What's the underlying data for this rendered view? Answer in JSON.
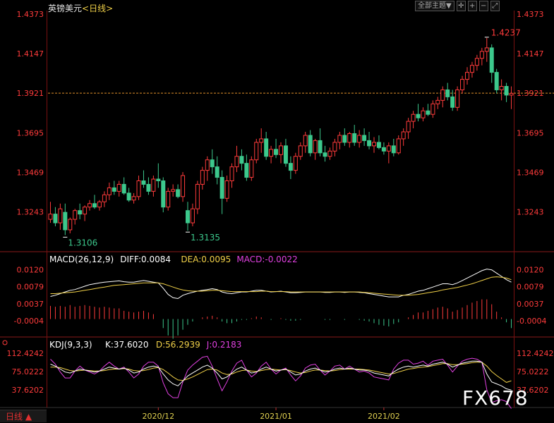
{
  "header": {
    "title": "英镑美元",
    "period_tag": "<日线>",
    "theme_label": "全部主题▼",
    "tool_icons": [
      "crosshair-icon",
      "zoom-in-icon",
      "zoom-out-icon",
      "expand-icon"
    ]
  },
  "footer": {
    "period_button": "日线 ▲",
    "watermark": "FX678"
  },
  "colors": {
    "up": "#ff3b3b",
    "down": "#3cc88c",
    "macd_diff": "#ffffff",
    "macd_dea": "#f0d048",
    "macd_bar": "#e040e0",
    "kdj_k": "#ffffff",
    "kdj_d": "#f0d048",
    "kdj_j": "#e040e0"
  },
  "chart_data": [
    {
      "type": "candlestick",
      "title": "英镑美元",
      "y_ticks": [
        "1.4373",
        "1.4147",
        "1.3921",
        "1.3695",
        "1.3469",
        "1.3243"
      ],
      "ylim": [
        1.3015,
        1.4373
      ],
      "current_price_line": 1.3921,
      "annotations": [
        {
          "label": "1.3106",
          "value": 1.3106,
          "index": 3,
          "kind": "low"
        },
        {
          "label": "1.3135",
          "value": 1.3135,
          "index": 28,
          "kind": "low"
        },
        {
          "label": "1.4237",
          "value": 1.4237,
          "index": 89,
          "kind": "high"
        }
      ],
      "x_ticks": [
        {
          "label": "2020/12",
          "index": 22
        },
        {
          "label": "2021/01",
          "index": 46
        },
        {
          "label": "2021/02",
          "index": 68
        }
      ],
      "ohlc": [
        [
          1.32,
          1.33,
          1.318,
          1.323
        ],
        [
          1.323,
          1.327,
          1.316,
          1.318
        ],
        [
          1.318,
          1.329,
          1.314,
          1.326
        ],
        [
          1.324,
          1.329,
          1.311,
          1.314
        ],
        [
          1.314,
          1.321,
          1.312,
          1.32
        ],
        [
          1.32,
          1.326,
          1.317,
          1.325
        ],
        [
          1.325,
          1.329,
          1.32,
          1.323
        ],
        [
          1.323,
          1.328,
          1.319,
          1.327
        ],
        [
          1.327,
          1.331,
          1.325,
          1.329
        ],
        [
          1.329,
          1.334,
          1.326,
          1.327
        ],
        [
          1.327,
          1.331,
          1.325,
          1.33
        ],
        [
          1.33,
          1.336,
          1.327,
          1.334
        ],
        [
          1.334,
          1.341,
          1.331,
          1.338
        ],
        [
          1.338,
          1.342,
          1.334,
          1.336
        ],
        [
          1.336,
          1.342,
          1.333,
          1.34
        ],
        [
          1.34,
          1.344,
          1.334,
          1.335
        ],
        [
          1.335,
          1.338,
          1.33,
          1.331
        ],
        [
          1.331,
          1.335,
          1.329,
          1.333
        ],
        [
          1.333,
          1.345,
          1.331,
          1.342
        ],
        [
          1.342,
          1.348,
          1.338,
          1.34
        ],
        [
          1.34,
          1.344,
          1.334,
          1.336
        ],
        [
          1.336,
          1.345,
          1.333,
          1.343
        ],
        [
          1.343,
          1.352,
          1.338,
          1.342
        ],
        [
          1.342,
          1.344,
          1.324,
          1.327
        ],
        [
          1.327,
          1.338,
          1.325,
          1.336
        ],
        [
          1.336,
          1.34,
          1.333,
          1.337
        ],
        [
          1.337,
          1.34,
          1.332,
          1.333
        ],
        [
          1.333,
          1.347,
          1.33,
          1.345
        ],
        [
          1.325,
          1.33,
          1.3135,
          1.318
        ],
        [
          1.318,
          1.329,
          1.316,
          1.326
        ],
        [
          1.326,
          1.342,
          1.323,
          1.34
        ],
        [
          1.34,
          1.35,
          1.337,
          1.348
        ],
        [
          1.348,
          1.356,
          1.342,
          1.354
        ],
        [
          1.354,
          1.36,
          1.346,
          1.35
        ],
        [
          1.35,
          1.356,
          1.34,
          1.344
        ],
        [
          1.344,
          1.348,
          1.323,
          1.332
        ],
        [
          1.332,
          1.345,
          1.33,
          1.342
        ],
        [
          1.342,
          1.352,
          1.338,
          1.35
        ],
        [
          1.35,
          1.362,
          1.347,
          1.356
        ],
        [
          1.356,
          1.36,
          1.348,
          1.352
        ],
        [
          1.352,
          1.357,
          1.342,
          1.344
        ],
        [
          1.344,
          1.356,
          1.342,
          1.354
        ],
        [
          1.354,
          1.366,
          1.352,
          1.364
        ],
        [
          1.364,
          1.372,
          1.358,
          1.366
        ],
        [
          1.366,
          1.37,
          1.354,
          1.356
        ],
        [
          1.356,
          1.362,
          1.352,
          1.36
        ],
        [
          1.36,
          1.366,
          1.355,
          1.357
        ],
        [
          1.357,
          1.364,
          1.352,
          1.362
        ],
        [
          1.362,
          1.366,
          1.35,
          1.352
        ],
        [
          1.352,
          1.356,
          1.343,
          1.348
        ],
        [
          1.348,
          1.358,
          1.346,
          1.356
        ],
        [
          1.356,
          1.364,
          1.354,
          1.362
        ],
        [
          1.362,
          1.37,
          1.358,
          1.368
        ],
        [
          1.368,
          1.371,
          1.356,
          1.358
        ],
        [
          1.358,
          1.366,
          1.354,
          1.365
        ],
        [
          1.365,
          1.372,
          1.356,
          1.358
        ],
        [
          1.358,
          1.362,
          1.353,
          1.356
        ],
        [
          1.356,
          1.361,
          1.354,
          1.359
        ],
        [
          1.359,
          1.366,
          1.356,
          1.364
        ],
        [
          1.364,
          1.37,
          1.36,
          1.368
        ],
        [
          1.368,
          1.372,
          1.362,
          1.364
        ],
        [
          1.364,
          1.37,
          1.361,
          1.369
        ],
        [
          1.369,
          1.374,
          1.362,
          1.364
        ],
        [
          1.364,
          1.371,
          1.361,
          1.368
        ],
        [
          1.368,
          1.372,
          1.362,
          1.365
        ],
        [
          1.365,
          1.37,
          1.36,
          1.362
        ],
        [
          1.362,
          1.367,
          1.358,
          1.364
        ],
        [
          1.364,
          1.368,
          1.36,
          1.361
        ],
        [
          1.361,
          1.364,
          1.357,
          1.359
        ],
        [
          1.359,
          1.364,
          1.352,
          1.362
        ],
        [
          1.362,
          1.366,
          1.356,
          1.358
        ],
        [
          1.358,
          1.368,
          1.357,
          1.366
        ],
        [
          1.366,
          1.372,
          1.362,
          1.37
        ],
        [
          1.37,
          1.378,
          1.366,
          1.376
        ],
        [
          1.376,
          1.382,
          1.372,
          1.38
        ],
        [
          1.38,
          1.386,
          1.376,
          1.378
        ],
        [
          1.378,
          1.384,
          1.376,
          1.382
        ],
        [
          1.382,
          1.386,
          1.379,
          1.38
        ],
        [
          1.38,
          1.388,
          1.378,
          1.386
        ],
        [
          1.386,
          1.39,
          1.383,
          1.388
        ],
        [
          1.388,
          1.396,
          1.384,
          1.394
        ],
        [
          1.394,
          1.398,
          1.388,
          1.39
        ],
        [
          1.39,
          1.394,
          1.382,
          1.384
        ],
        [
          1.384,
          1.396,
          1.382,
          1.394
        ],
        [
          1.394,
          1.402,
          1.392,
          1.4
        ],
        [
          1.4,
          1.407,
          1.397,
          1.404
        ],
        [
          1.404,
          1.41,
          1.401,
          1.408
        ],
        [
          1.408,
          1.414,
          1.405,
          1.412
        ],
        [
          1.412,
          1.418,
          1.408,
          1.416
        ],
        [
          1.416,
          1.4237,
          1.41,
          1.418
        ],
        [
          1.418,
          1.42,
          1.398,
          1.404
        ],
        [
          1.404,
          1.406,
          1.392,
          1.394
        ],
        [
          1.394,
          1.4,
          1.388,
          1.396
        ],
        [
          1.396,
          1.398,
          1.387,
          1.391
        ],
        [
          1.391,
          1.396,
          1.383,
          1.392
        ]
      ]
    },
    {
      "type": "line",
      "title": "MACD(26,12,9)",
      "legend": [
        {
          "label": "MACD(26,12,9)",
          "color": "#ffffff"
        },
        {
          "label": "DIFF:0.0084",
          "color": "#ffffff"
        },
        {
          "label": "DEA:0.0095",
          "color": "#f0d048"
        },
        {
          "label": "MACD:-0.0022",
          "color": "#e040e0"
        }
      ],
      "y_ticks": [
        "0.0120",
        "0.0079",
        "0.0037",
        "-0.0004"
      ],
      "ylim": [
        -0.003,
        0.0135
      ],
      "diff": [
        0.0055,
        0.0058,
        0.0062,
        0.0066,
        0.007,
        0.0072,
        0.0076,
        0.008,
        0.0084,
        0.0086,
        0.0088,
        0.009,
        0.0091,
        0.0092,
        0.0093,
        0.0091,
        0.009,
        0.009,
        0.0092,
        0.0094,
        0.0092,
        0.009,
        0.0088,
        0.0075,
        0.006,
        0.0052,
        0.005,
        0.0058,
        0.0062,
        0.0065,
        0.0068,
        0.007,
        0.0072,
        0.0074,
        0.0072,
        0.0066,
        0.0063,
        0.0062,
        0.0064,
        0.0066,
        0.0066,
        0.0068,
        0.007,
        0.007,
        0.0068,
        0.0066,
        0.0067,
        0.0068,
        0.0066,
        0.0064,
        0.0064,
        0.0065,
        0.0066,
        0.0066,
        0.0066,
        0.0066,
        0.0065,
        0.0065,
        0.0066,
        0.0066,
        0.0065,
        0.0066,
        0.0066,
        0.0065,
        0.0064,
        0.0062,
        0.006,
        0.0058,
        0.0056,
        0.0054,
        0.0054,
        0.0054,
        0.0058,
        0.006,
        0.0064,
        0.0068,
        0.007,
        0.0074,
        0.0078,
        0.0082,
        0.0086,
        0.0086,
        0.0084,
        0.0088,
        0.0094,
        0.01,
        0.0106,
        0.0112,
        0.0118,
        0.0122,
        0.012,
        0.0112,
        0.0104,
        0.0096,
        0.009
      ],
      "dea": [
        0.0062,
        0.0062,
        0.0063,
        0.0064,
        0.0065,
        0.0066,
        0.0068,
        0.007,
        0.0072,
        0.0074,
        0.0076,
        0.0078,
        0.008,
        0.0082,
        0.0083,
        0.0084,
        0.0085,
        0.0086,
        0.0087,
        0.0088,
        0.0088,
        0.0088,
        0.0088,
        0.0086,
        0.0082,
        0.0078,
        0.0074,
        0.0071,
        0.0069,
        0.0068,
        0.0068,
        0.0068,
        0.0069,
        0.007,
        0.007,
        0.0069,
        0.0068,
        0.0067,
        0.0067,
        0.0067,
        0.0067,
        0.0067,
        0.0067,
        0.0068,
        0.0068,
        0.0067,
        0.0067,
        0.0067,
        0.0067,
        0.0066,
        0.0066,
        0.0066,
        0.0066,
        0.0066,
        0.0066,
        0.0066,
        0.0066,
        0.0066,
        0.0066,
        0.0066,
        0.0066,
        0.0066,
        0.0066,
        0.0066,
        0.0065,
        0.0064,
        0.0063,
        0.0062,
        0.0061,
        0.006,
        0.0059,
        0.0058,
        0.0058,
        0.0058,
        0.0059,
        0.006,
        0.0062,
        0.0064,
        0.0066,
        0.0068,
        0.0071,
        0.0073,
        0.0075,
        0.0077,
        0.008,
        0.0083,
        0.0086,
        0.009,
        0.0094,
        0.0098,
        0.0102,
        0.0103,
        0.0102,
        0.01,
        0.0096
      ],
      "hist": [
        0.0032,
        0.003,
        0.0032,
        0.003,
        0.0034,
        0.003,
        0.0032,
        0.0034,
        0.0032,
        0.003,
        0.0028,
        0.003,
        0.0028,
        0.0026,
        0.0026,
        0.002,
        0.0018,
        0.0016,
        0.0018,
        0.002,
        0.0016,
        0.0012,
        0.0,
        -0.0022,
        -0.004,
        -0.0048,
        -0.004,
        -0.0026,
        -0.0014,
        -0.0006,
        0.0,
        0.0004,
        0.0006,
        0.0008,
        0.0004,
        -0.0006,
        -0.001,
        -0.001,
        -0.0006,
        -0.0002,
        -0.0002,
        0.0002,
        0.0006,
        0.0004,
        0.0,
        -0.0002,
        0.0,
        0.0002,
        -0.0002,
        -0.0004,
        -0.0004,
        -0.0002,
        0.0,
        0.0,
        0.0,
        0.0,
        -0.0002,
        -0.0002,
        0.0,
        0.0,
        -0.0002,
        0.0,
        0.0,
        -0.0002,
        -0.0004,
        -0.0006,
        -0.001,
        -0.0014,
        -0.0016,
        -0.0018,
        -0.0012,
        -0.0008,
        0.0,
        0.0004,
        0.001,
        0.0016,
        0.0016,
        0.002,
        0.0024,
        0.0028,
        0.003,
        0.0026,
        0.0018,
        0.0022,
        0.0028,
        0.0034,
        0.004,
        0.0044,
        0.0048,
        0.0048,
        0.0036,
        0.0018,
        0.0004,
        -0.0008,
        -0.0022
      ]
    },
    {
      "type": "line",
      "title": "KDJ(9,3,3)",
      "legend": [
        {
          "label": "KDJ(9,3,3)",
          "color": "#ffffff"
        },
        {
          "label": "K:37.6020",
          "color": "#ffffff"
        },
        {
          "label": "D:56.2939",
          "color": "#f0d048"
        },
        {
          "label": "J:0.2183",
          "color": "#e040e0"
        }
      ],
      "y_ticks": [
        "112.4242",
        "75.0222",
        "37.6202"
      ],
      "ylim": [
        5,
        125
      ],
      "k": [
        90,
        86,
        80,
        74,
        72,
        76,
        80,
        78,
        76,
        74,
        76,
        80,
        84,
        82,
        80,
        82,
        78,
        72,
        74,
        80,
        84,
        86,
        84,
        70,
        58,
        50,
        46,
        56,
        66,
        72,
        78,
        84,
        88,
        82,
        72,
        60,
        64,
        72,
        80,
        84,
        78,
        72,
        74,
        80,
        84,
        80,
        76,
        78,
        80,
        74,
        68,
        70,
        76,
        80,
        82,
        78,
        74,
        76,
        80,
        82,
        80,
        82,
        80,
        78,
        78,
        76,
        72,
        70,
        68,
        66,
        74,
        80,
        84,
        86,
        84,
        86,
        88,
        86,
        90,
        92,
        94,
        90,
        84,
        88,
        92,
        94,
        96,
        96,
        94,
        70,
        54,
        50,
        46,
        40,
        37.6
      ],
      "d": [
        84,
        84,
        83,
        80,
        77,
        76,
        77,
        78,
        77,
        76,
        76,
        77,
        79,
        80,
        80,
        81,
        80,
        77,
        76,
        77,
        79,
        82,
        83,
        79,
        72,
        64,
        58,
        57,
        60,
        64,
        69,
        74,
        79,
        80,
        78,
        72,
        69,
        70,
        74,
        77,
        78,
        76,
        75,
        77,
        79,
        80,
        79,
        78,
        79,
        77,
        74,
        72,
        73,
        76,
        78,
        78,
        77,
        76,
        77,
        79,
        80,
        80,
        80,
        80,
        79,
        78,
        76,
        74,
        72,
        70,
        71,
        74,
        77,
        80,
        81,
        83,
        84,
        85,
        87,
        89,
        91,
        91,
        89,
        89,
        90,
        91,
        93,
        94,
        94,
        86,
        75,
        67,
        60,
        53,
        56.3
      ],
      "j": [
        100,
        90,
        74,
        62,
        62,
        76,
        86,
        78,
        74,
        70,
        76,
        86,
        94,
        86,
        80,
        84,
        74,
        62,
        70,
        86,
        94,
        94,
        86,
        52,
        30,
        22,
        22,
        54,
        78,
        88,
        96,
        104,
        106,
        86,
        60,
        36,
        54,
        76,
        92,
        98,
        78,
        64,
        72,
        86,
        94,
        80,
        70,
        78,
        82,
        68,
        56,
        66,
        82,
        88,
        90,
        78,
        68,
        76,
        86,
        88,
        80,
        86,
        80,
        74,
        76,
        72,
        64,
        62,
        60,
        58,
        80,
        92,
        98,
        98,
        90,
        92,
        96,
        88,
        96,
        98,
        100,
        88,
        74,
        86,
        96,
        100,
        102,
        100,
        94,
        38,
        12,
        16,
        18,
        14,
        0.2
      ]
    }
  ]
}
